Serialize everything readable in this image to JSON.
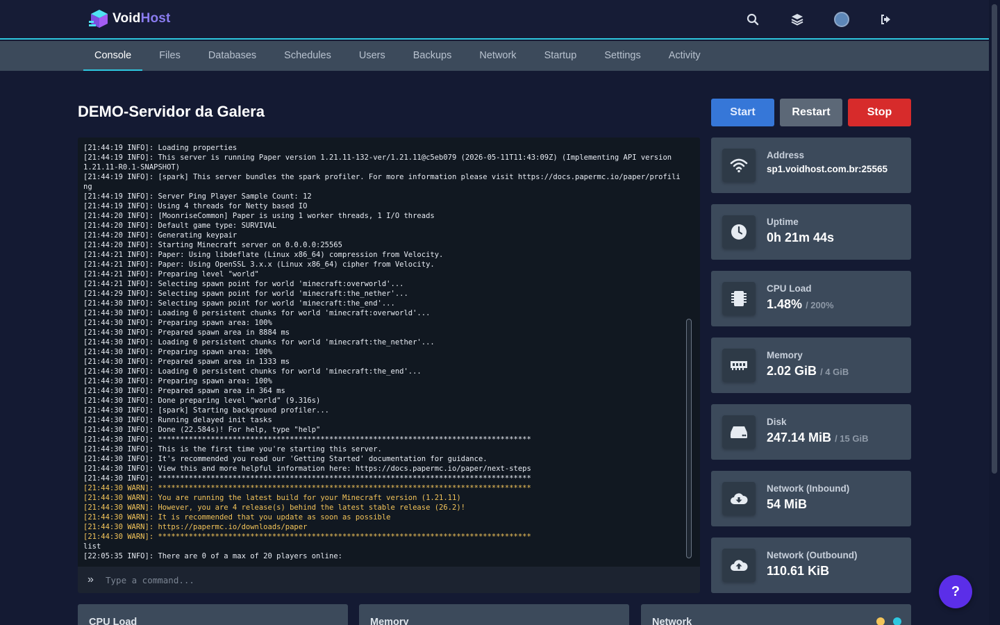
{
  "brand": {
    "part1": "Void",
    "part2": "Host"
  },
  "nav": {
    "tabs": [
      {
        "label": "Console",
        "active": true
      },
      {
        "label": "Files"
      },
      {
        "label": "Databases"
      },
      {
        "label": "Schedules"
      },
      {
        "label": "Users"
      },
      {
        "label": "Backups"
      },
      {
        "label": "Network"
      },
      {
        "label": "Startup"
      },
      {
        "label": "Settings"
      },
      {
        "label": "Activity"
      }
    ]
  },
  "server": {
    "name": "DEMO-Servidor da Galera"
  },
  "buttons": {
    "start": "Start",
    "restart": "Restart",
    "stop": "Stop"
  },
  "console": {
    "lines": [
      {
        "text": "[21:44:19 INFO]: Loading properties"
      },
      {
        "text": "[21:44:19 INFO]: This server is running Paper version 1.21.11-132-ver/1.21.11@c5eb079 (2026-05-11T11:43:09Z) (Implementing API version 1.21.11-R0.1-SNAPSHOT)"
      },
      {
        "text": "[21:44:19 INFO]: [spark] This server bundles the spark profiler. For more information please visit https://docs.papermc.io/paper/profiling"
      },
      {
        "text": "[21:44:19 INFO]: Server Ping Player Sample Count: 12"
      },
      {
        "text": "[21:44:19 INFO]: Using 4 threads for Netty based IO"
      },
      {
        "text": "[21:44:20 INFO]: [MoonriseCommon] Paper is using 1 worker threads, 1 I/O threads"
      },
      {
        "text": "[21:44:20 INFO]: Default game type: SURVIVAL"
      },
      {
        "text": "[21:44:20 INFO]: Generating keypair"
      },
      {
        "text": "[21:44:20 INFO]: Starting Minecraft server on 0.0.0.0:25565"
      },
      {
        "text": "[21:44:21 INFO]: Paper: Using libdeflate (Linux x86_64) compression from Velocity."
      },
      {
        "text": "[21:44:21 INFO]: Paper: Using OpenSSL 3.x.x (Linux x86_64) cipher from Velocity."
      },
      {
        "text": "[21:44:21 INFO]: Preparing level \"world\""
      },
      {
        "text": "[21:44:21 INFO]: Selecting spawn point for world 'minecraft:overworld'..."
      },
      {
        "text": "[21:44:29 INFO]: Selecting spawn point for world 'minecraft:the_nether'..."
      },
      {
        "text": "[21:44:30 INFO]: Selecting spawn point for world 'minecraft:the_end'..."
      },
      {
        "text": "[21:44:30 INFO]: Loading 0 persistent chunks for world 'minecraft:overworld'..."
      },
      {
        "text": "[21:44:30 INFO]: Preparing spawn area: 100%"
      },
      {
        "text": "[21:44:30 INFO]: Prepared spawn area in 8884 ms"
      },
      {
        "text": "[21:44:30 INFO]: Loading 0 persistent chunks for world 'minecraft:the_nether'..."
      },
      {
        "text": "[21:44:30 INFO]: Preparing spawn area: 100%"
      },
      {
        "text": "[21:44:30 INFO]: Prepared spawn area in 1333 ms"
      },
      {
        "text": "[21:44:30 INFO]: Loading 0 persistent chunks for world 'minecraft:the_end'..."
      },
      {
        "text": "[21:44:30 INFO]: Preparing spawn area: 100%"
      },
      {
        "text": "[21:44:30 INFO]: Prepared spawn area in 364 ms"
      },
      {
        "text": "[21:44:30 INFO]: Done preparing level \"world\" (9.316s)"
      },
      {
        "text": "[21:44:30 INFO]: [spark] Starting background profiler..."
      },
      {
        "text": "[21:44:30 INFO]: Running delayed init tasks"
      },
      {
        "text": "[21:44:30 INFO]: Done (22.584s)! For help, type \"help\""
      },
      {
        "text": "[21:44:30 INFO]: *************************************************************************************"
      },
      {
        "text": "[21:44:30 INFO]: This is the first time you're starting this server."
      },
      {
        "text": "[21:44:30 INFO]: It's recommended you read our 'Getting Started' documentation for guidance."
      },
      {
        "text": "[21:44:30 INFO]: View this and more helpful information here: https://docs.papermc.io/paper/next-steps"
      },
      {
        "text": "[21:44:30 INFO]: *************************************************************************************"
      },
      {
        "text": "[21:44:30 WARN]: *************************************************************************************",
        "level": "warn"
      },
      {
        "text": "[21:44:30 WARN]: You are running the latest build for your Minecraft version (1.21.11)",
        "level": "warn"
      },
      {
        "text": "[21:44:30 WARN]: However, you are 4 release(s) behind the latest stable release (26.2)!",
        "level": "warn"
      },
      {
        "text": "[21:44:30 WARN]: It is recommended that you update as soon as possible",
        "level": "warn"
      },
      {
        "text": "[21:44:30 WARN]: https://papermc.io/downloads/paper",
        "level": "warn"
      },
      {
        "text": "[21:44:30 WARN]: *************************************************************************************",
        "level": "warn"
      },
      {
        "text": "list"
      },
      {
        "text": "[22:05:35 INFO]: There are 0 of a max of 20 players online:"
      }
    ],
    "input_placeholder": "Type a command..."
  },
  "stats": {
    "address": {
      "label": "Address",
      "value": "sp1.voidhost.com.br:25565",
      "icon": "wifi-icon"
    },
    "uptime": {
      "label": "Uptime",
      "value": "0h 21m 44s",
      "icon": "clock-icon"
    },
    "cpu": {
      "label": "CPU Load",
      "value": "1.48%",
      "limit": "/ 200%",
      "icon": "chip-icon"
    },
    "memory": {
      "label": "Memory",
      "value": "2.02 GiB",
      "limit": "/ 4 GiB",
      "icon": "memory-icon"
    },
    "disk": {
      "label": "Disk",
      "value": "247.14 MiB",
      "limit": "/ 15 GiB",
      "icon": "hdd-icon"
    },
    "net_in": {
      "label": "Network (Inbound)",
      "value": "54 MiB",
      "icon": "cloud-download-icon"
    },
    "net_out": {
      "label": "Network (Outbound)",
      "value": "110.61 KiB",
      "icon": "cloud-upload-icon"
    }
  },
  "graphs": [
    {
      "title": "CPU Load"
    },
    {
      "title": "Memory"
    },
    {
      "title": "Network"
    }
  ],
  "help": {
    "label": "?"
  },
  "colors": {
    "accent": "#2ec8e0",
    "start": "#3677d8",
    "restart": "#5c6877",
    "stop": "#d72b2b",
    "warn": "#f4c55a",
    "help": "#5b2ee8"
  }
}
